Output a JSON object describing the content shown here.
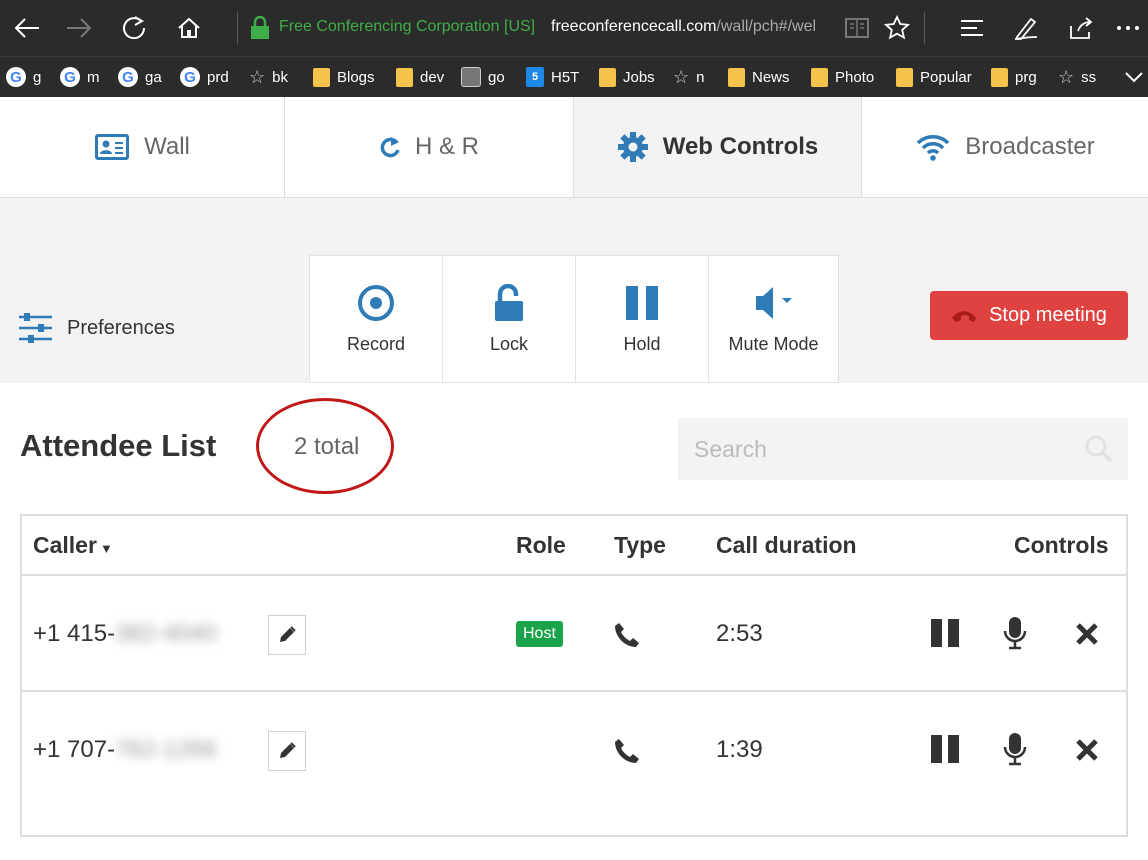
{
  "browser": {
    "site_identity": "Free Conferencing Corporation [US]",
    "url_domain": "freeconferencecall.com",
    "url_path": "/wall/pch#/wel"
  },
  "favorites": [
    {
      "icon": "google-icon",
      "label": "g"
    },
    {
      "icon": "google-icon",
      "label": "m"
    },
    {
      "icon": "google-icon",
      "label": "ga"
    },
    {
      "icon": "google-icon",
      "label": "prd"
    },
    {
      "icon": "star-icon",
      "label": "bk"
    },
    {
      "icon": "folder-icon",
      "label": "Blogs"
    },
    {
      "icon": "folder-icon",
      "label": "dev"
    },
    {
      "icon": "avatar-icon",
      "label": "go"
    },
    {
      "icon": "html5-icon",
      "label": "H5T"
    },
    {
      "icon": "folder-icon",
      "label": "Jobs"
    },
    {
      "icon": "star-icon",
      "label": "n"
    },
    {
      "icon": "folder-icon",
      "label": "News"
    },
    {
      "icon": "folder-icon",
      "label": "Photo"
    },
    {
      "icon": "folder-icon",
      "label": "Popular"
    },
    {
      "icon": "folder-icon",
      "label": "prg"
    },
    {
      "icon": "star-icon",
      "label": "ss"
    }
  ],
  "tabs": [
    {
      "label": "Wall",
      "icon": "id-card-icon"
    },
    {
      "label": "H & R",
      "icon": "refresh-icon"
    },
    {
      "label": "Web Controls",
      "icon": "gear-icon",
      "active": true
    },
    {
      "label": "Broadcaster",
      "icon": "wifi-icon"
    }
  ],
  "controls": {
    "preferences": "Preferences",
    "record": "Record",
    "lock": "Lock",
    "hold": "Hold",
    "mute_mode": "Mute Mode",
    "stop_meeting": "Stop meeting"
  },
  "attendees": {
    "title": "Attendee List",
    "total": "2 total",
    "search_placeholder": "Search",
    "columns": {
      "caller": "Caller",
      "role": "Role",
      "type": "Type",
      "duration": "Call duration",
      "controls": "Controls"
    },
    "rows": [
      {
        "phone_prefix": "+1 415-",
        "phone_hidden": "382-4040",
        "role": "Host",
        "duration": "2:53"
      },
      {
        "phone_prefix": "+1 707-",
        "phone_hidden": "762-1266",
        "role": "",
        "duration": "1:39"
      }
    ]
  },
  "colors": {
    "accent_blue": "#2e7bb8",
    "stop_red": "#e04141",
    "host_green": "#1aa34a",
    "secure_green": "#3fae49"
  }
}
